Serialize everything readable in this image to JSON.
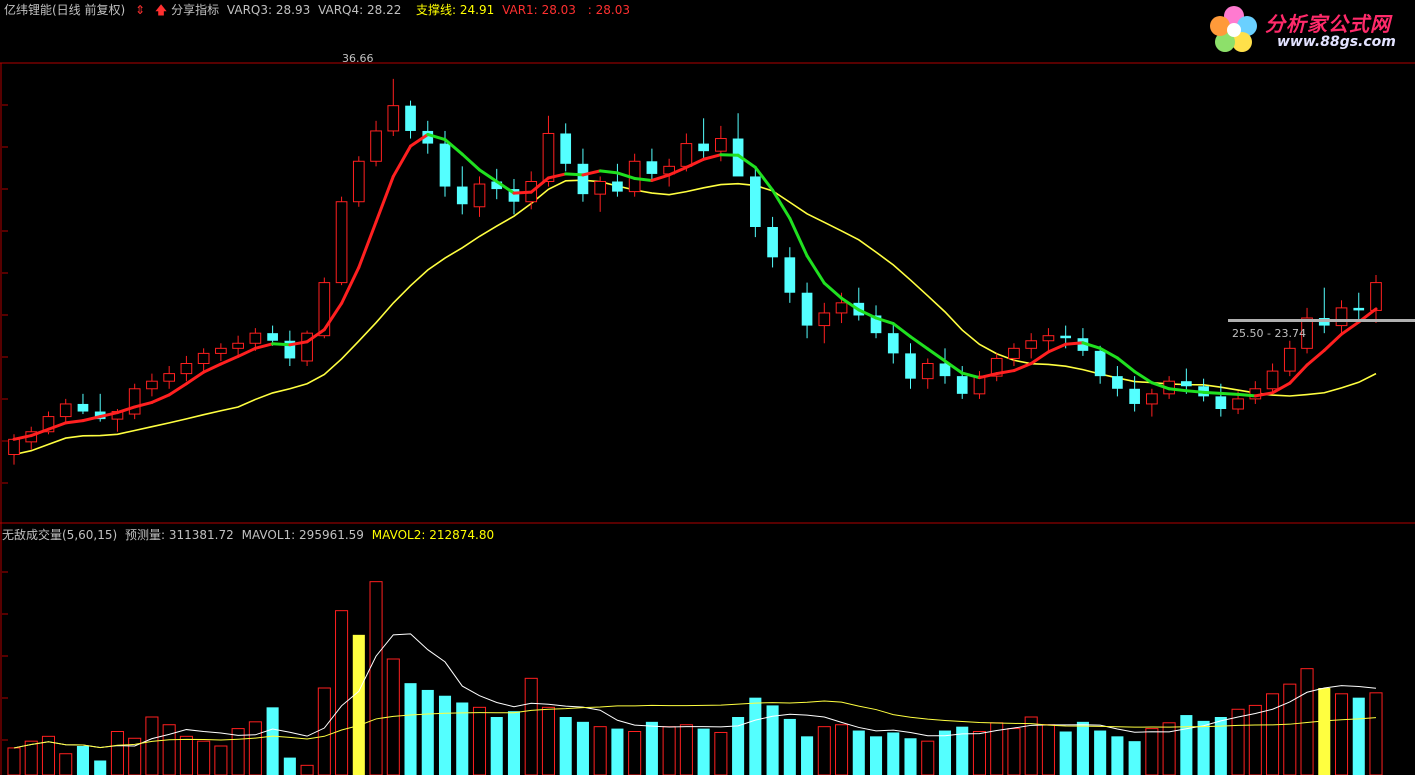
{
  "header": {
    "title": "亿纬锂能(日线 前复权)",
    "indicator_name": "分享指标",
    "varq3_label": "VARQ3:",
    "varq3_value": "28.93",
    "varq4_label": "VARQ4:",
    "varq4_value": "28.22",
    "support_label": "支撑线:",
    "support_value": "24.91",
    "var1_label": "VAR1:",
    "var1_value": "28.03",
    "extra_label": ":",
    "extra_value": "28.03"
  },
  "logo": {
    "title": "分析家公式网",
    "url": "www.88gs.com"
  },
  "volume_header": {
    "title": "无敌成交量(5,60,15)",
    "forecast_label": "预测量:",
    "forecast_value": "311381.72",
    "mavol1_label": "MAVOL1:",
    "mavol1_value": "295961.59",
    "mavol2_label": "MAVOL2:",
    "mavol2_value": "212874.80"
  },
  "colors": {
    "up": "#ff2020",
    "down": "#54ffff",
    "white_candle": "#ffffff",
    "magenta": "#ff20c0",
    "ma_red": "#ff2020",
    "ma_green": "#20e020",
    "ma_yellow": "#ffff40",
    "axis": "#c00000",
    "text": "#c0c0c0",
    "yellow_text": "#ffff00",
    "blue_star": "#2040ff"
  },
  "chart_data": [
    {
      "type": "candlestick",
      "ylim": [
        20,
        38
      ],
      "price_labels": [
        {
          "text": "36.66",
          "x": 40,
          "y": 36.66
        },
        {
          "text": "25.50 - 23.74",
          "x": 148,
          "y": 25.0
        }
      ],
      "ohlc": [
        [
          21.8,
          22.6,
          21.4,
          22.4
        ],
        [
          22.3,
          22.9,
          22.0,
          22.7
        ],
        [
          22.7,
          23.5,
          22.6,
          23.3
        ],
        [
          23.3,
          24.0,
          23.0,
          23.8
        ],
        [
          23.8,
          24.2,
          23.4,
          23.5
        ],
        [
          23.5,
          24.2,
          23.1,
          23.2
        ],
        [
          23.2,
          23.6,
          22.7,
          23.5
        ],
        [
          23.4,
          24.6,
          23.2,
          24.4
        ],
        [
          24.4,
          25.0,
          24.1,
          24.7
        ],
        [
          24.7,
          25.3,
          24.4,
          25.0
        ],
        [
          25.0,
          25.7,
          24.7,
          25.4
        ],
        [
          25.4,
          26.0,
          25.0,
          25.8
        ],
        [
          25.8,
          26.2,
          25.5,
          26.0
        ],
        [
          26.0,
          26.5,
          25.7,
          26.2
        ],
        [
          26.2,
          26.8,
          25.9,
          26.6
        ],
        [
          26.6,
          26.9,
          26.1,
          26.3
        ],
        [
          26.3,
          26.7,
          25.3,
          25.6
        ],
        [
          25.5,
          26.7,
          25.3,
          26.6
        ],
        [
          26.5,
          28.8,
          26.4,
          28.6
        ],
        [
          28.6,
          32.0,
          28.5,
          31.8
        ],
        [
          31.8,
          33.6,
          31.6,
          33.4
        ],
        [
          33.4,
          35.0,
          33.2,
          34.6
        ],
        [
          34.6,
          36.66,
          34.4,
          35.6
        ],
        [
          35.6,
          35.8,
          34.3,
          34.6
        ],
        [
          34.6,
          35.0,
          33.7,
          34.1
        ],
        [
          34.1,
          34.6,
          32.0,
          32.4
        ],
        [
          32.4,
          33.2,
          31.3,
          31.7
        ],
        [
          31.6,
          32.8,
          31.2,
          32.5
        ],
        [
          32.6,
          33.1,
          31.9,
          32.3
        ],
        [
          32.3,
          32.7,
          31.3,
          31.8
        ],
        [
          31.8,
          33.0,
          31.5,
          32.6
        ],
        [
          32.6,
          35.2,
          32.4,
          34.5
        ],
        [
          34.5,
          34.9,
          33.0,
          33.3
        ],
        [
          33.3,
          33.9,
          31.8,
          32.1
        ],
        [
          32.1,
          32.8,
          31.4,
          32.6
        ],
        [
          32.6,
          33.3,
          32.0,
          32.2
        ],
        [
          32.2,
          33.7,
          32.0,
          33.4
        ],
        [
          33.4,
          33.9,
          32.6,
          32.9
        ],
        [
          32.9,
          33.5,
          32.4,
          33.2
        ],
        [
          33.2,
          34.5,
          33.0,
          34.1
        ],
        [
          34.1,
          35.1,
          33.5,
          33.8
        ],
        [
          33.8,
          34.8,
          33.4,
          34.3
        ],
        [
          34.3,
          35.3,
          32.9,
          32.8
        ],
        [
          32.8,
          33.2,
          30.4,
          30.8
        ],
        [
          30.8,
          31.2,
          29.2,
          29.6
        ],
        [
          29.6,
          30.0,
          27.8,
          28.2
        ],
        [
          28.2,
          28.6,
          26.4,
          26.9
        ],
        [
          26.9,
          27.8,
          26.2,
          27.4
        ],
        [
          27.4,
          28.2,
          27.0,
          27.8
        ],
        [
          27.8,
          28.4,
          27.1,
          27.3
        ],
        [
          27.3,
          27.7,
          26.4,
          26.6
        ],
        [
          26.6,
          27.0,
          25.4,
          25.8
        ],
        [
          25.8,
          26.2,
          24.4,
          24.8
        ],
        [
          24.8,
          25.6,
          24.4,
          25.4
        ],
        [
          25.4,
          26.0,
          24.6,
          24.9
        ],
        [
          24.9,
          25.3,
          24.0,
          24.2
        ],
        [
          24.2,
          25.1,
          24.0,
          24.9
        ],
        [
          24.9,
          25.8,
          24.7,
          25.6
        ],
        [
          25.6,
          26.2,
          25.3,
          26.0
        ],
        [
          26.0,
          26.6,
          25.6,
          26.3
        ],
        [
          26.3,
          26.8,
          25.8,
          26.5
        ],
        [
          26.5,
          26.9,
          26.0,
          26.4
        ],
        [
          26.4,
          26.8,
          25.7,
          25.9
        ],
        [
          25.9,
          26.1,
          24.6,
          24.9
        ],
        [
          24.9,
          25.3,
          24.1,
          24.4
        ],
        [
          24.4,
          24.9,
          23.5,
          23.8
        ],
        [
          23.8,
          24.4,
          23.3,
          24.2
        ],
        [
          24.2,
          24.9,
          24.0,
          24.7
        ],
        [
          24.7,
          25.2,
          24.2,
          24.5
        ],
        [
          24.5,
          24.8,
          23.9,
          24.1
        ],
        [
          24.1,
          24.6,
          23.3,
          23.6
        ],
        [
          23.6,
          24.3,
          23.4,
          24.0
        ],
        [
          24.0,
          24.7,
          23.8,
          24.4
        ],
        [
          24.4,
          25.4,
          24.2,
          25.1
        ],
        [
          25.1,
          26.3,
          24.9,
          26.0
        ],
        [
          26.0,
          27.6,
          25.8,
          27.2
        ],
        [
          27.2,
          28.4,
          26.6,
          26.9
        ],
        [
          26.9,
          27.9,
          26.5,
          27.6
        ],
        [
          27.6,
          28.2,
          27.1,
          27.5
        ],
        [
          27.5,
          28.9,
          27.0,
          28.6
        ]
      ]
    },
    {
      "type": "bar",
      "ylim": [
        0,
        240
      ],
      "volume": [
        28,
        35,
        40,
        22,
        30,
        15,
        45,
        38,
        60,
        52,
        40,
        35,
        30,
        48,
        55,
        70,
        18,
        10,
        90,
        170,
        145,
        200,
        120,
        95,
        88,
        82,
        75,
        70,
        60,
        66,
        100,
        70,
        60,
        55,
        50,
        48,
        45,
        55,
        50,
        52,
        48,
        44,
        60,
        80,
        72,
        58,
        40,
        50,
        52,
        46,
        40,
        44,
        38,
        35,
        46,
        50,
        45,
        54,
        48,
        60,
        52,
        45,
        55,
        46,
        40,
        35,
        48,
        54,
        62,
        56,
        60,
        68,
        72,
        84,
        94,
        110,
        90,
        84,
        80,
        85
      ]
    }
  ]
}
